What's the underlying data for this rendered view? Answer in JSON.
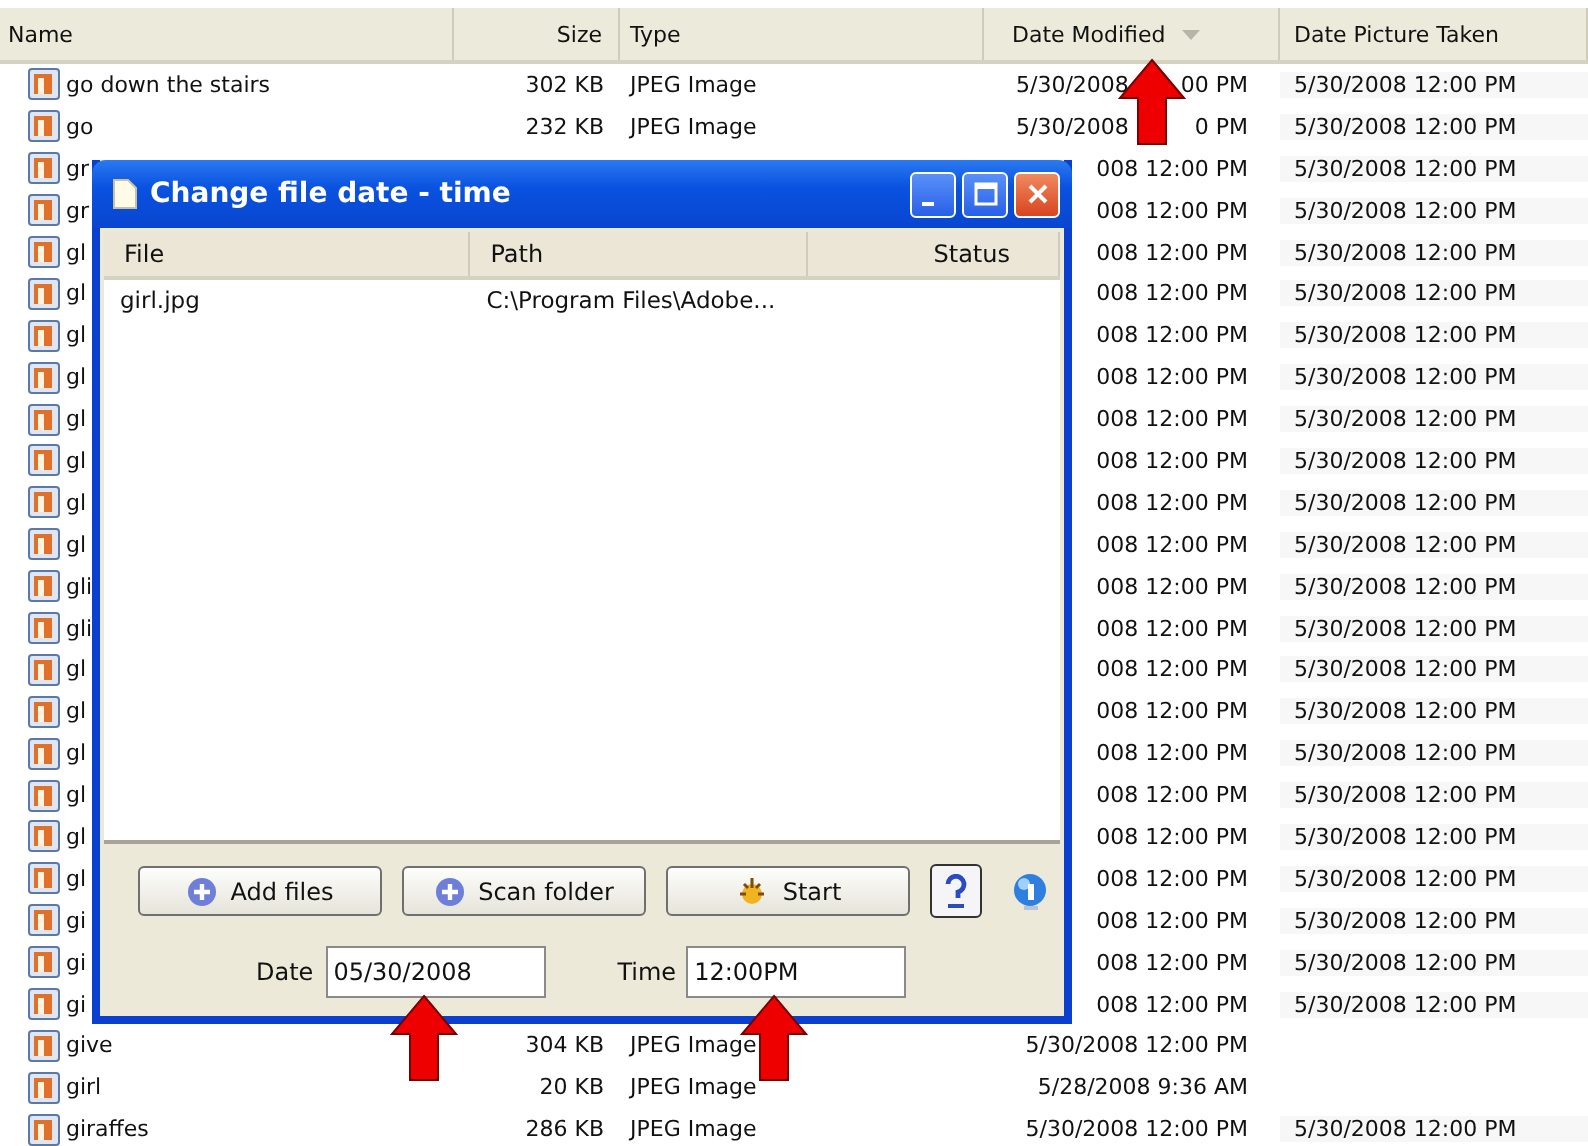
{
  "explorer": {
    "columns": [
      {
        "label": "Name",
        "sorted": false
      },
      {
        "label": "Size",
        "sorted": false
      },
      {
        "label": "Type",
        "sorted": false
      },
      {
        "label": "Date Modified",
        "sorted": true
      },
      {
        "label": "Date Picture Taken",
        "sorted": false
      }
    ],
    "rows": [
      {
        "name": "go down the stairs",
        "size": "302 KB",
        "type": "JPEG Image",
        "date_modified": [
          "5/30/2008",
          "00 PM"
        ],
        "date_taken": "5/30/2008 12:00 PM"
      },
      {
        "name": "go",
        "size": "232 KB",
        "type": "JPEG Image",
        "date_modified": [
          "5/30/2008",
          "0 PM"
        ],
        "date_taken": "5/30/2008 12:00 PM"
      },
      {
        "name": "gr",
        "date_modified": "008 12:00 PM",
        "date_taken": "5/30/2008 12:00 PM"
      },
      {
        "name": "gr",
        "date_modified": "008 12:00 PM",
        "date_taken": "5/30/2008 12:00 PM"
      },
      {
        "name": "gl",
        "date_modified": "008 12:00 PM",
        "date_taken": "5/30/2008 12:00 PM"
      },
      {
        "name": "gl",
        "date_modified": "008 12:00 PM",
        "date_taken": "5/30/2008 12:00 PM"
      },
      {
        "name": "gl",
        "date_modified": "008 12:00 PM",
        "date_taken": "5/30/2008 12:00 PM"
      },
      {
        "name": "gl",
        "date_modified": "008 12:00 PM",
        "date_taken": "5/30/2008 12:00 PM"
      },
      {
        "name": "gl",
        "date_modified": "008 12:00 PM",
        "date_taken": "5/30/2008 12:00 PM"
      },
      {
        "name": "gl",
        "date_modified": "008 12:00 PM",
        "date_taken": "5/30/2008 12:00 PM"
      },
      {
        "name": "gl",
        "date_modified": "008 12:00 PM",
        "date_taken": "5/30/2008 12:00 PM"
      },
      {
        "name": "gl",
        "date_modified": "008 12:00 PM",
        "date_taken": "5/30/2008 12:00 PM"
      },
      {
        "name": "gli",
        "date_modified": "008 12:00 PM",
        "date_taken": "5/30/2008 12:00 PM"
      },
      {
        "name": "gli",
        "date_modified": "008 12:00 PM",
        "date_taken": "5/30/2008 12:00 PM"
      },
      {
        "name": "gl",
        "date_modified": "008 12:00 PM",
        "date_taken": "5/30/2008 12:00 PM"
      },
      {
        "name": "gl",
        "date_modified": "008 12:00 PM",
        "date_taken": "5/30/2008 12:00 PM"
      },
      {
        "name": "gl",
        "date_modified": "008 12:00 PM",
        "date_taken": "5/30/2008 12:00 PM"
      },
      {
        "name": "gl",
        "date_modified": "008 12:00 PM",
        "date_taken": "5/30/2008 12:00 PM"
      },
      {
        "name": "gl",
        "date_modified": "008 12:00 PM",
        "date_taken": "5/30/2008 12:00 PM"
      },
      {
        "name": "gl",
        "date_modified": "008 12:00 PM",
        "date_taken": "5/30/2008 12:00 PM"
      },
      {
        "name": "gi",
        "date_modified": "008 12:00 PM",
        "date_taken": "5/30/2008 12:00 PM"
      },
      {
        "name": "gi",
        "date_modified": "008 12:00 PM",
        "date_taken": "5/30/2008 12:00 PM"
      },
      {
        "name": "gi",
        "date_modified": "008 12:00 PM",
        "date_taken": "5/30/2008 12:00 PM"
      },
      {
        "name": "give",
        "size": "304 KB",
        "type": "JPEG Image",
        "date_modified": "5/30/2008 12:00 PM"
      },
      {
        "name": "girl",
        "size": "20 KB",
        "type": "JPEG Image",
        "date_modified": "5/28/2008 9:36 AM"
      },
      {
        "name": "giraffes",
        "size": "286 KB",
        "type": "JPEG Image",
        "date_modified": "5/30/2008 12:00 PM",
        "date_taken": "5/30/2008 12:00 PM"
      }
    ]
  },
  "dialog": {
    "title": "Change file date - time",
    "columns": [
      "File",
      "Path",
      "Status"
    ],
    "rows": [
      {
        "file": "girl.jpg",
        "path": "C:\\Program Files\\Adobe..."
      }
    ],
    "buttons": [
      {
        "label": "Add files",
        "kind": "add"
      },
      {
        "label": "Scan folder",
        "kind": "add"
      },
      {
        "label": "Start",
        "kind": "start"
      }
    ],
    "date": {
      "label": "Date",
      "value": "05/30/2008"
    },
    "time": {
      "label": "Time",
      "value": "12:00PM"
    }
  }
}
